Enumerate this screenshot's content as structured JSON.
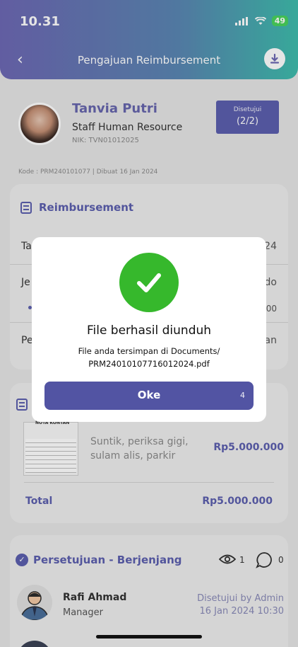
{
  "status_bar": {
    "time": "10.31",
    "battery": "49"
  },
  "header": {
    "title": "Pengajuan Reimbursement"
  },
  "profile": {
    "name": "Tanvia Putri",
    "role": "Staff Human Resource",
    "nik": "NIK: TVN01012025",
    "status_label": "Disetujui",
    "status_count": "(2/2)"
  },
  "kode": "Kode : PRM240101077 | Dibuat 16 Jan 2024",
  "reimbursement": {
    "title": "Reimbursement",
    "row1_label": "Ta",
    "row1_value": "24",
    "row2_label": "Je",
    "row2_value": "do",
    "row3_value": "00",
    "row4_label": "Pe",
    "row4_value": "an"
  },
  "items": {
    "nota_title": "NOTA KONTAN",
    "description": "Suntik, periksa gigi, sulam alis, parkir",
    "amount": "Rp5.000.000",
    "total_label": "Total",
    "total_amount": "Rp5.000.000"
  },
  "approval": {
    "title": "Persetujuan - Berjenjang",
    "views": "1",
    "comments": "0",
    "approver_name": "Rafi Ahmad",
    "approver_role": "Manager",
    "approved_by": "Disetujui by Admin",
    "approved_date": "16 Jan 2024 10:30"
  },
  "modal": {
    "title": "File berhasil diunduh",
    "message_line1": "File anda tersimpan di Documents/",
    "message_line2": "PRM24010107716012024.pdf",
    "ok_label": "Oke",
    "ok_countdown": "4"
  },
  "colors": {
    "primary": "#5c5fae",
    "success": "#36b82c"
  }
}
